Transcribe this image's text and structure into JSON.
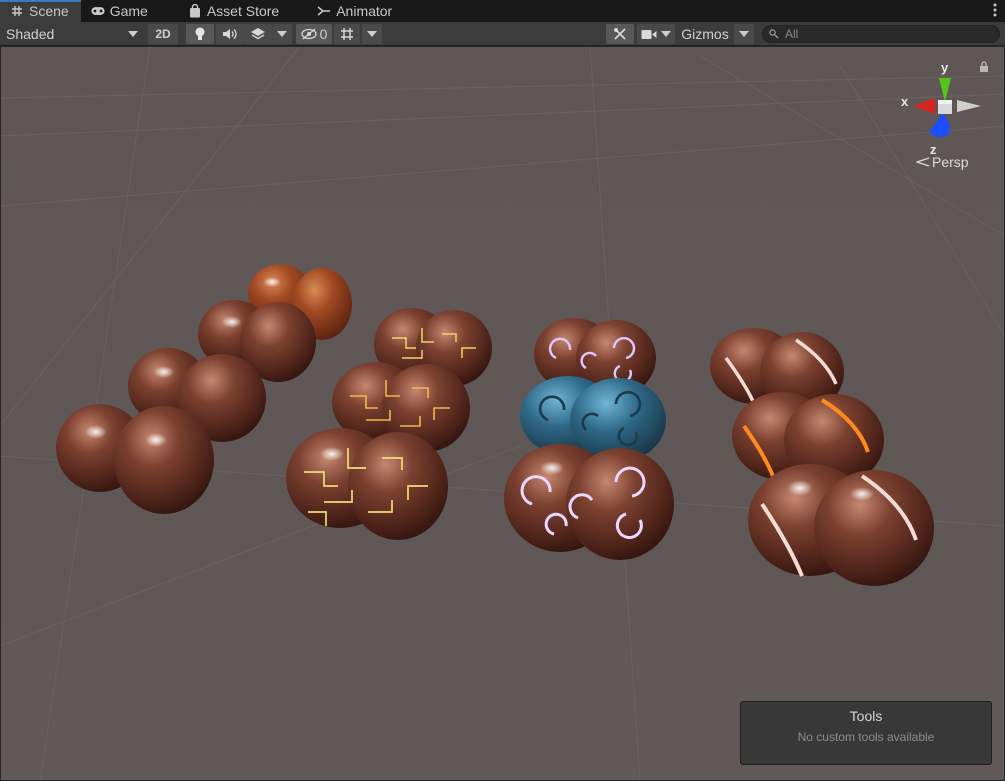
{
  "tabs": [
    {
      "label": "Scene",
      "icon": "hash-icon",
      "active": true
    },
    {
      "label": "Game",
      "icon": "gamepad-icon",
      "active": false
    },
    {
      "label": "Asset Store",
      "icon": "shopping-bag-icon",
      "active": false
    },
    {
      "label": "Animator",
      "icon": "animator-icon",
      "active": false
    }
  ],
  "toolbar": {
    "draw_mode": "Shaded",
    "mode_2d": "2D",
    "hidden_count": "0",
    "gizmos_label": "Gizmos",
    "search_placeholder": "All"
  },
  "gizmo": {
    "axis_x": "x",
    "axis_y": "y",
    "axis_z": "z",
    "projection": "Persp"
  },
  "tools_panel": {
    "title": "Tools",
    "message": "No custom tools available"
  },
  "colors": {
    "accent": "#3a79bb",
    "viewport_bg": "#5c5552",
    "axis_x": "#d7231f",
    "axis_y": "#52c41a",
    "axis_z": "#1c4dff"
  }
}
